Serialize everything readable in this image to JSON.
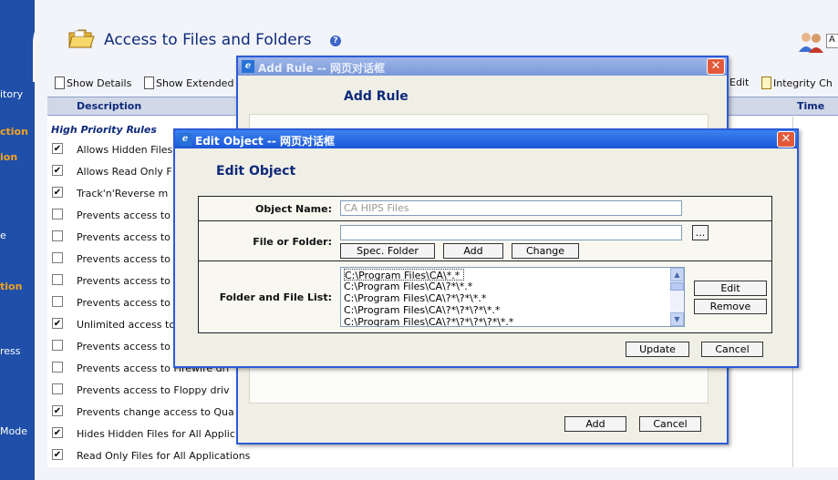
{
  "left_nav": {
    "items": [
      {
        "label": "itory",
        "style": "white"
      },
      {
        "label": "ction",
        "style": "orange"
      },
      {
        "label": "ion",
        "style": "orange"
      },
      {
        "label": "e",
        "style": "white"
      },
      {
        "label": "tion",
        "style": "orange"
      },
      {
        "label": "ress",
        "style": "white"
      },
      {
        "label": "Mode",
        "style": "white"
      }
    ]
  },
  "header": {
    "title": "Access to Files and Folders",
    "help_glyph": "?",
    "search_value": "A"
  },
  "toolbar": {
    "show_details": "Show Details",
    "show_extended": "Show Extended",
    "edit": "Edit",
    "integrity": "Integrity Ch"
  },
  "grid": {
    "columns": {
      "description": "Description",
      "time": "Time"
    },
    "group_label": "High Priority Rules",
    "rows": [
      {
        "checked": true,
        "text": "Allows Hidden Files"
      },
      {
        "checked": true,
        "text": "Allows Read Only F"
      },
      {
        "checked": true,
        "text": "Track'n'Reverse m"
      },
      {
        "checked": false,
        "text": "Prevents access to"
      },
      {
        "checked": false,
        "text": "Prevents access to"
      },
      {
        "checked": false,
        "text": "Prevents access to"
      },
      {
        "checked": false,
        "text": "Prevents access to"
      },
      {
        "checked": false,
        "text": "Prevents access to"
      },
      {
        "checked": true,
        "text": "Unlimited access to"
      },
      {
        "checked": false,
        "text": "Prevents access to"
      },
      {
        "checked": false,
        "text": "Prevents access to Firewire dri"
      },
      {
        "checked": false,
        "text": "Prevents access to Floppy driv"
      },
      {
        "checked": true,
        "text": "Prevents change access to Qua"
      },
      {
        "checked": true,
        "text": "Hides Hidden Files for All Applic"
      },
      {
        "checked": true,
        "text": "Read Only Files for All Applications"
      }
    ]
  },
  "add_rule_dialog": {
    "title": "Add Rule -- 网页对话框",
    "heading": "Add Rule",
    "add_button": "Add",
    "cancel_button": "Cancel",
    "close_glyph": "✕"
  },
  "edit_object_dialog": {
    "title": "Edit Object -- 网页对话框",
    "heading": "Edit Object",
    "close_glyph": "✕",
    "object_name_label": "Object Name:",
    "object_name_placeholder": "CA HIPS Files",
    "file_or_folder_label": "File or Folder:",
    "file_or_folder_value": "",
    "browse_button": "...",
    "spec_folder_button": "Spec. Folder",
    "add_button": "Add",
    "change_button": "Change",
    "folder_list_label": "Folder and File List:",
    "folder_list": [
      "C:\\Program Files\\CA\\*.*",
      "C:\\Program Files\\CA\\?*\\*.*",
      "C:\\Program Files\\CA\\?*\\?*\\*.*",
      "C:\\Program Files\\CA\\?*\\?*\\?*\\*.*",
      "C:\\Program Files\\CA\\?*\\?*\\?*\\?*\\*.*"
    ],
    "selected_index": 0,
    "edit_button": "Edit",
    "remove_button": "Remove",
    "update_button": "Update",
    "cancel_button": "Cancel"
  }
}
